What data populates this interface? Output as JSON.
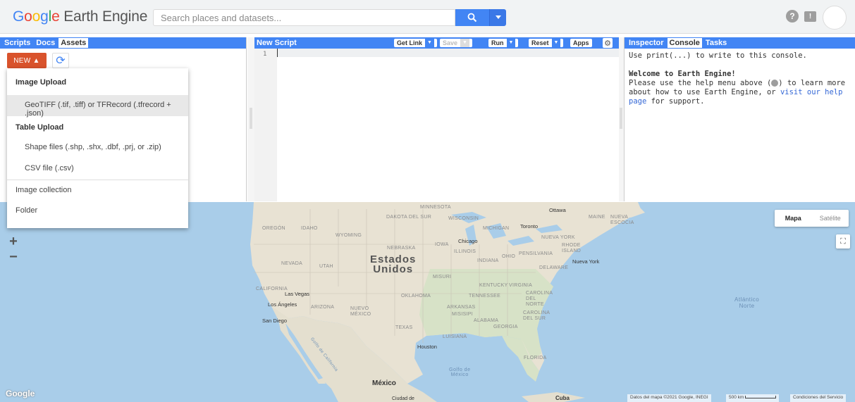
{
  "header": {
    "logo_google": "Google",
    "logo_product": "Earth Engine",
    "search_placeholder": "Search places and datasets..."
  },
  "left_panel": {
    "tabs": [
      "Scripts",
      "Docs",
      "Assets"
    ],
    "active_tab": "Assets",
    "new_button_label": "NEW ▲",
    "menu": {
      "image_upload_header": "Image Upload",
      "geotiff_item": "GeoTIFF (.tif, .tiff) or TFRecord (.tfrecord + .json)",
      "table_upload_header": "Table Upload",
      "shape_files_item": "Shape files (.shp, .shx, .dbf, .prj, or .zip)",
      "csv_item": "CSV file (.csv)",
      "image_collection_item": "Image collection",
      "folder_item": "Folder"
    }
  },
  "editor": {
    "title": "New Script",
    "get_link_label": "Get Link",
    "save_label": "Save",
    "run_label": "Run",
    "reset_label": "Reset",
    "apps_label": "Apps",
    "line_number": "1"
  },
  "right_panel": {
    "tabs": [
      "Inspector",
      "Console",
      "Tasks"
    ],
    "active_tab": "Console",
    "console_hint": "Use print(...) to write to this console.",
    "welcome_title": "Welcome to Earth Engine!",
    "welcome_line1": "Please use the help menu above (",
    "welcome_line1b": ") to learn more",
    "welcome_line2": "about how to use Earth Engine, or ",
    "visit_link": "visit our help",
    "welcome_line3_link": "page",
    "welcome_line3": " for support."
  },
  "map": {
    "map_type_options": [
      "Mapa",
      "Satélite"
    ],
    "selected_map_type": "Mapa",
    "country_label_line1": "Estados",
    "country_label_line2": "Unidos",
    "mexico_label": "México",
    "cuba_label": "Cuba",
    "ocean_label_line1": "Atlántico",
    "ocean_label_line2": "Norte",
    "gulf_label_line1": "Golfo de",
    "gulf_label_line2": "México",
    "gulf_california_label": "Golfo de California",
    "ciudad_label": "Ciudad de",
    "cities": [
      "Ottawa",
      "Toronto",
      "Chicago",
      "Nueva York",
      "Los Ángeles",
      "Las Vegas",
      "San Diego",
      "Houston"
    ],
    "regions": [
      "MINNESOTA",
      "DAKOTA DEL SUR",
      "WISCONSIN",
      "MICHIGAN",
      "OREGÓN",
      "IDAHO",
      "WYOMING",
      "NEBRASKA",
      "IOWA",
      "ILLINOIS",
      "INDIANA",
      "OHIO",
      "PENSILVANIA",
      "NEVADA",
      "UTAH",
      "MISURI",
      "KENTUCKY",
      "VIRGINIA",
      "CALIFORNIA",
      "ARIZONA",
      "NUEVO MÉXICO",
      "OKLAHOMA",
      "ARKANSAS",
      "TENNESSEE",
      "CAROLINA DEL NORTE",
      "CAROLINA DEL SUR",
      "MISISIPI",
      "ALABAMA",
      "GEORGIA",
      "TEXAS",
      "LUISIANA",
      "FLORIDA",
      "NUEVA YORK",
      "MAINE",
      "NUEVA ESCOCIA",
      "RHODE ISLAND",
      "DELAWARE"
    ],
    "attribution": "Datos del mapa ©2021 Google, INEGI",
    "scale_label": "500 km",
    "terms_label": "Condiciones del Servicio",
    "google_logo": "Google"
  }
}
